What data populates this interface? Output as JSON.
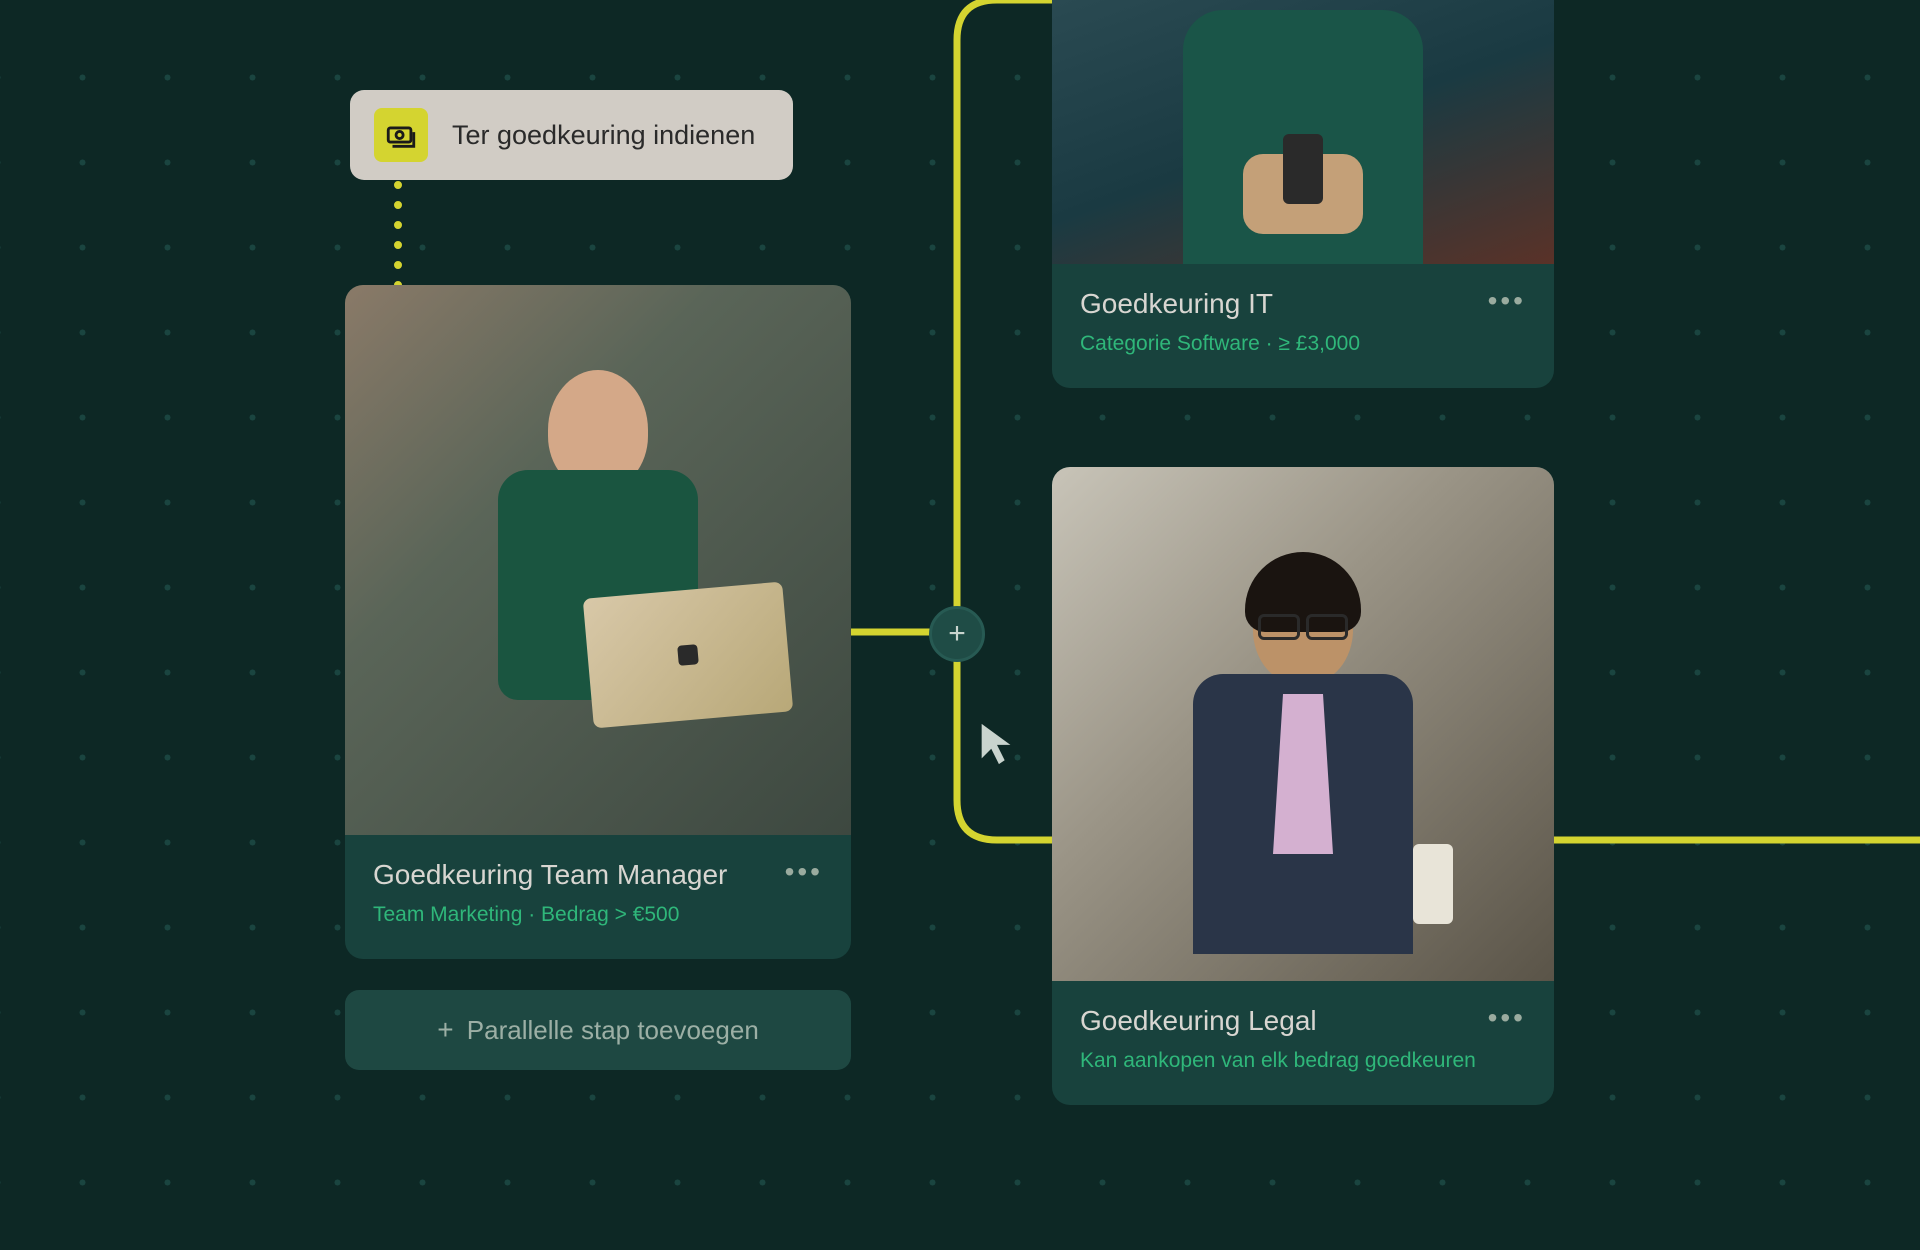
{
  "submit": {
    "label": "Ter goedkeuring indienen"
  },
  "cards": {
    "team_manager": {
      "title": "Goedkeuring Team Manager",
      "meta": "Team Marketing  ·  Bedrag  >  €500"
    },
    "it": {
      "title": "Goedkeuring IT",
      "meta": "Categorie Software  ·   ≥ £3,000"
    },
    "legal": {
      "title": "Goedkeuring Legal",
      "meta": "Kan aankopen van elk bedrag goedkeuren"
    }
  },
  "parallel_step": {
    "label": "Parallelle stap toevoegen"
  },
  "colors": {
    "accent_yellow": "#d4d430",
    "connector": "#d4d430",
    "meta_green": "#2fb77a",
    "card_bg": "#18423d",
    "page_bg": "#0d2825"
  }
}
